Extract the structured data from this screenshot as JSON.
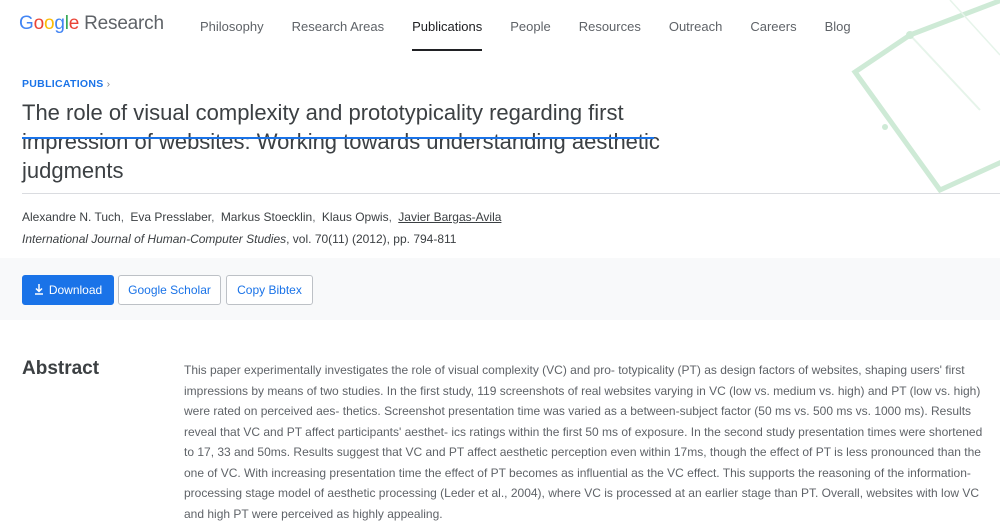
{
  "header": {
    "logo": {
      "letters": [
        "G",
        "o",
        "o",
        "g",
        "l",
        "e"
      ],
      "research": "Research"
    },
    "nav": [
      {
        "label": "Philosophy",
        "active": false
      },
      {
        "label": "Research Areas",
        "active": false
      },
      {
        "label": "Publications",
        "active": true
      },
      {
        "label": "People",
        "active": false
      },
      {
        "label": "Resources",
        "active": false
      },
      {
        "label": "Outreach",
        "active": false
      },
      {
        "label": "Careers",
        "active": false
      },
      {
        "label": "Blog",
        "active": false
      }
    ]
  },
  "breadcrumb": {
    "label": "PUBLICATIONS",
    "separator": "›"
  },
  "paper": {
    "title": "The role of visual complexity and prototypicality regarding first impression of websites: Working towards understanding aesthetic judgments",
    "authors": [
      {
        "name": "Alexandre N. Tuch",
        "linked": false
      },
      {
        "name": "Eva Presslaber",
        "linked": false
      },
      {
        "name": "Markus Stoecklin",
        "linked": false
      },
      {
        "name": "Klaus Opwis",
        "linked": false
      },
      {
        "name": "Javier Bargas-Avila",
        "linked": true
      }
    ],
    "author_separator": ",",
    "journal": "International Journal of Human-Computer Studies",
    "citation_rest": ", vol. 70(11) (2012), pp. 794-811"
  },
  "actions": {
    "download_label": "Download",
    "scholar_label": "Google Scholar",
    "bibtex_label": "Copy Bibtex",
    "download_icon": "download-icon"
  },
  "abstract": {
    "heading": "Abstract",
    "text": "This paper experimentally investigates the role of visual complexity (VC) and pro- totypicality (PT) as design factors of websites, shaping users' first impressions by means of two studies. In the first study, 119 screenshots of real websites varying in VC (low vs. medium vs. high) and PT (low vs. high) were rated on perceived aes- thetics. Screenshot presentation time was varied as a between-subject factor (50 ms vs. 500 ms vs. 1000 ms). Results reveal that VC and PT affect participants' aesthet- ics ratings within the first 50 ms of exposure. In the second study presentation times were shortened to 17, 33 and 50ms. Results suggest that VC and PT affect aesthetic perception even within 17ms, though the effect of PT is less pronounced than the one of VC. With increasing presentation time the effect of PT becomes as influential as the VC effect. This supports the reasoning of the information-processing stage model of aesthetic processing (Leder et al., 2004), where VC is processed at an earlier stage than PT. Overall, websites with low VC and high PT were perceived as highly appealing."
  },
  "colors": {
    "accent": "#1a73e8",
    "text": "#3c4043",
    "muted": "#5f6368",
    "band": "#f8f9fa",
    "deco_green": "#ceead6"
  }
}
